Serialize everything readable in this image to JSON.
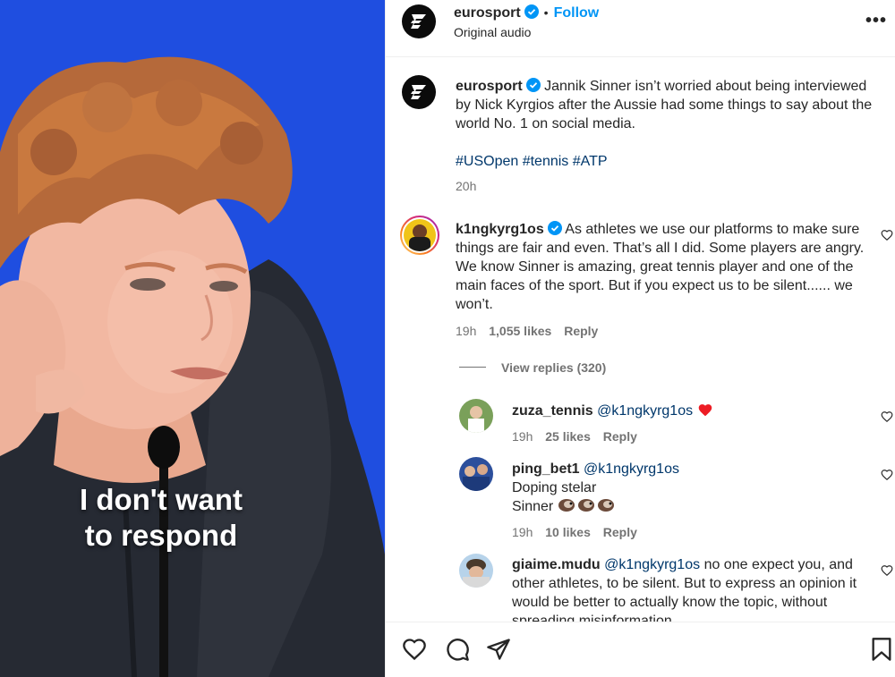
{
  "video": {
    "caption_line1": "I don't want",
    "caption_line2": "to respond"
  },
  "header": {
    "username": "eurosport",
    "follow": "Follow",
    "audio": "Original audio",
    "more": "•••"
  },
  "post": {
    "username": "eurosport",
    "caption": "Jannik Sinner isn’t worried about being interviewed by Nick Kyrgios after the Aussie had some things to say about the world No. 1 on social media.",
    "hashtags": "#USOpen #tennis #ATP",
    "time": "20h"
  },
  "comments": [
    {
      "username": "k1ngkyrg1os",
      "text": "As athletes we use our platforms to make sure things are fair and even. That’s all I did. Some players are angry. We know Sinner is amazing, great tennis player and one of the main faces of the sport. But if you expect us to be silent...... we won’t.",
      "time": "19h",
      "likes": "1,055 likes",
      "reply": "Reply",
      "view_replies": "View replies (320)"
    }
  ],
  "replies": [
    {
      "username": "zuza_tennis",
      "mention": "@k1ngkyrg1os",
      "text": "",
      "time": "19h",
      "likes": "25 likes",
      "reply": "Reply"
    },
    {
      "username": "ping_bet1",
      "mention": "@k1ngkyrg1os",
      "text_line1": "Doping stelar",
      "text_line2": "Sinner",
      "time": "19h",
      "likes": "10 likes",
      "reply": "Reply"
    },
    {
      "username": "giaime.mudu",
      "mention": "@k1ngkyrg1os",
      "text": "no one expect you, and other athletes, to be silent. But to express an opinion it would be better to actually know the topic, without spreading misinformation"
    }
  ],
  "colors": {
    "link": "#0095f6",
    "mention": "#00376b",
    "muted": "#737373",
    "video_bg": "#1f4fd6",
    "heart_red": "#ed1c24"
  },
  "icons": [
    "like-icon",
    "comment-icon",
    "share-icon",
    "save-icon",
    "verified-icon",
    "heart-emoji",
    "clown-emoji"
  ]
}
